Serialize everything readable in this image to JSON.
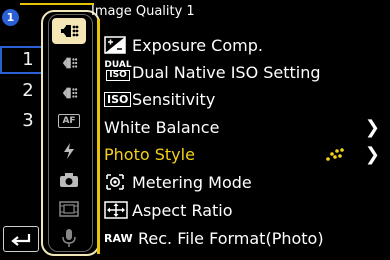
{
  "header": {
    "title": "Image Quality 1",
    "page_badge": "1"
  },
  "pages": [
    "1",
    "2",
    "3"
  ],
  "tabs": [
    {
      "icon": "camera-menu-icon",
      "active": true
    },
    {
      "icon": "camera-menu-icon"
    },
    {
      "icon": "camera-menu-icon"
    },
    {
      "icon": "af-icon",
      "text": "AF"
    },
    {
      "icon": "flash-icon"
    },
    {
      "icon": "camera-icon"
    },
    {
      "icon": "film-icon"
    },
    {
      "icon": "microphone-icon"
    }
  ],
  "menu": [
    {
      "label": "Exposure Comp.",
      "icon": "exposure-comp-icon"
    },
    {
      "label": "Dual Native ISO Setting",
      "icon": "dual-iso-icon",
      "icon_text_1": "DUAL",
      "icon_text_2": "ISO"
    },
    {
      "label": "Sensitivity",
      "icon": "iso-icon",
      "icon_text": "ISO"
    },
    {
      "label": "White Balance",
      "has_submenu": true
    },
    {
      "label": "Photo Style",
      "selected": true,
      "has_submenu": true
    },
    {
      "label": "Metering Mode",
      "icon": "metering-icon"
    },
    {
      "label": "Aspect Ratio",
      "icon": "aspect-ratio-icon"
    },
    {
      "label": "Rec. File Format(Photo)",
      "icon": "raw-icon",
      "icon_text": "RAW"
    }
  ],
  "colors": {
    "accent_yellow": "#f5d11a",
    "accent_blue": "#2a5fd6"
  }
}
